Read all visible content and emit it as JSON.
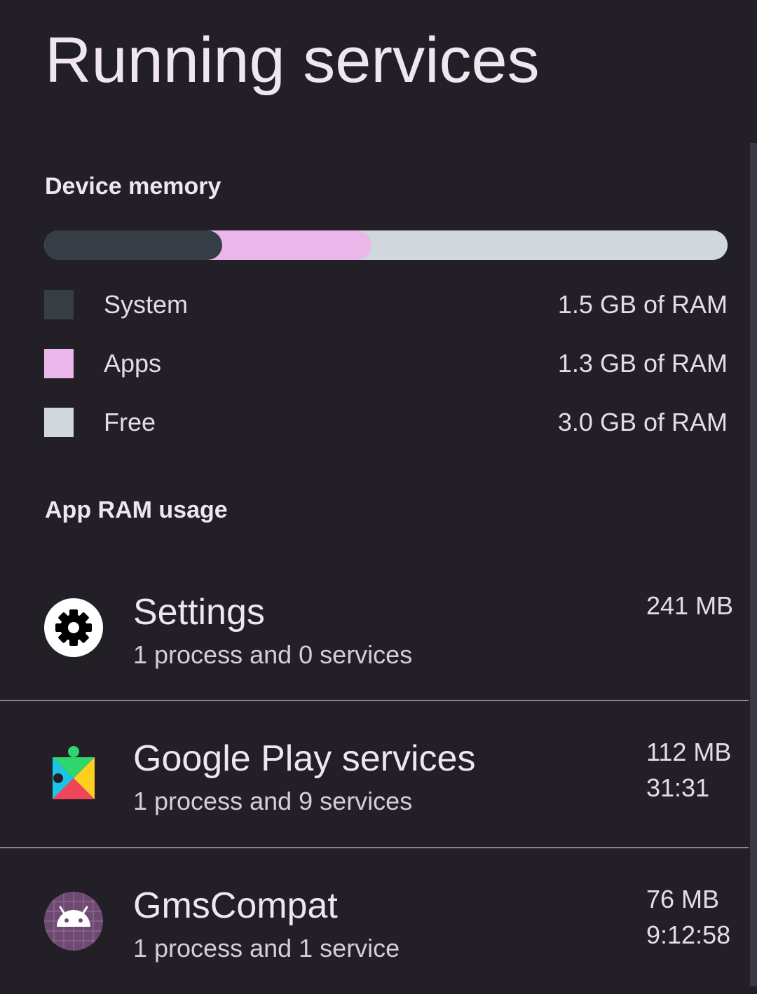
{
  "page": {
    "title": "Running services"
  },
  "device_memory": {
    "header": "Device memory",
    "legend": [
      {
        "label": "System",
        "value": "1.5 GB of RAM",
        "color": "#363d44"
      },
      {
        "label": "Apps",
        "value": "1.3 GB of RAM",
        "color": "#ebb7eb"
      },
      {
        "label": "Free",
        "value": "3.0 GB of RAM",
        "color": "#d0d8dd"
      }
    ],
    "bar_fractions": {
      "system": 0.26,
      "apps": 0.2186,
      "free": 0.5214
    }
  },
  "app_ram": {
    "header": "App RAM usage",
    "apps": [
      {
        "name": "Settings",
        "summary": "1 process and 0 services",
        "size": "241 MB",
        "time": "",
        "icon": "settings-icon"
      },
      {
        "name": "Google Play services",
        "summary": "1 process and 9 services",
        "size": "112 MB",
        "time": "31:31",
        "icon": "google-play-services-icon"
      },
      {
        "name": "GmsCompat",
        "summary": "1 process and 1 service",
        "size": "76 MB",
        "time": "9:12:58",
        "icon": "android-icon"
      }
    ]
  }
}
